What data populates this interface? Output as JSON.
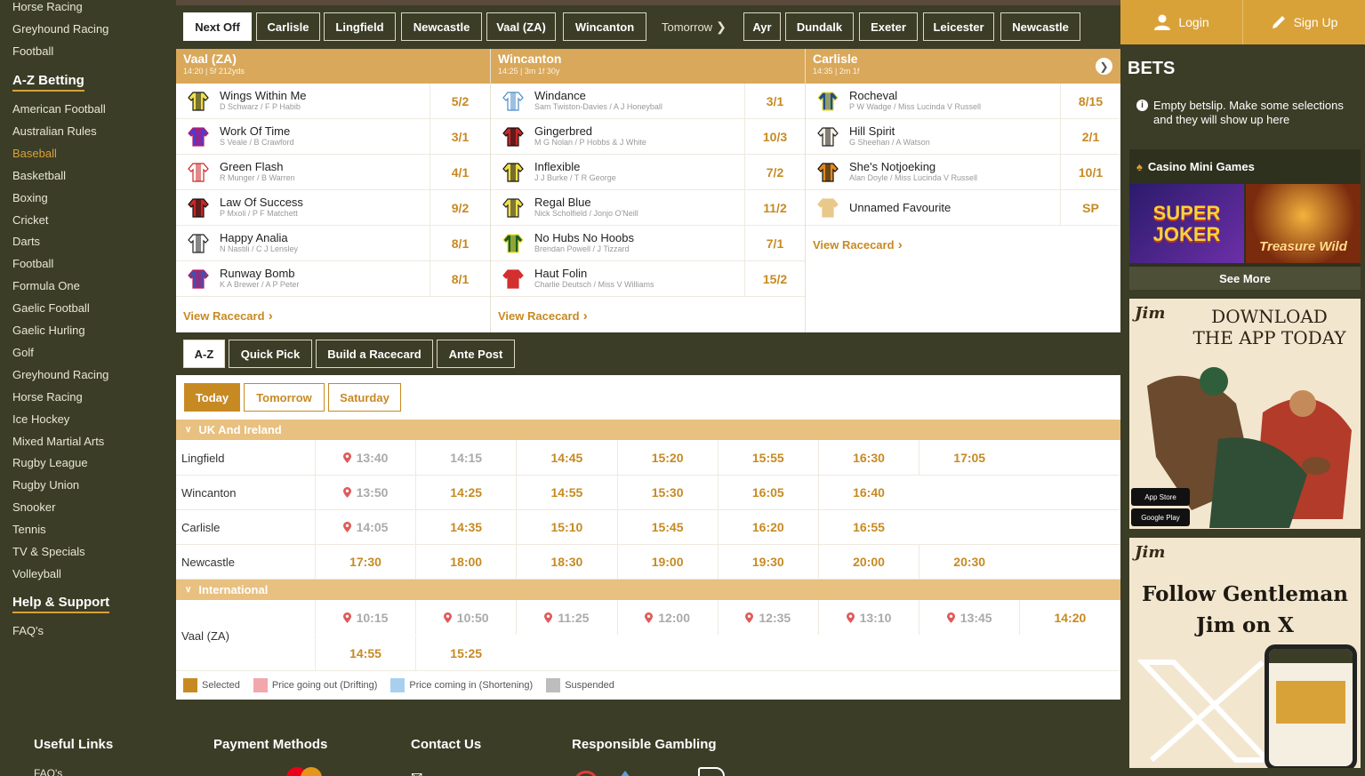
{
  "sidebar": {
    "top_links": [
      "Horse Racing",
      "Greyhound Racing",
      "Football"
    ],
    "az_heading": "A-Z Betting",
    "az_items": [
      "American Football",
      "Australian Rules",
      "Baseball",
      "Basketball",
      "Boxing",
      "Cricket",
      "Darts",
      "Football",
      "Formula One",
      "Gaelic Football",
      "Gaelic Hurling",
      "Golf",
      "Greyhound Racing",
      "Horse Racing",
      "Ice Hockey",
      "Mixed Martial Arts",
      "Rugby League",
      "Rugby Union",
      "Snooker",
      "Tennis",
      "TV & Specials",
      "Volleyball"
    ],
    "active_item": "Baseball",
    "help_heading": "Help & Support",
    "help_items": [
      "FAQ's"
    ]
  },
  "top_tabs": {
    "today": [
      "Next Off",
      "Carlisle",
      "Lingfield",
      "Newcastle",
      "Vaal (ZA)",
      "Wincanton"
    ],
    "tomorrow_label": "Tomorrow",
    "tomorrow": [
      "Ayr",
      "Dundalk",
      "Exeter",
      "Leicester",
      "Newcastle"
    ]
  },
  "races": [
    {
      "title": "Vaal (ZA)",
      "sub": "14:20 | 5f 212yds",
      "runners": [
        {
          "name": "Wings Within Me",
          "jt": "D Schwarz / F P Habib",
          "odds": "5/2"
        },
        {
          "name": "Work Of Time",
          "jt": "S Veale / B Crawford",
          "odds": "3/1"
        },
        {
          "name": "Green Flash",
          "jt": "R Munger / B Warren",
          "odds": "4/1"
        },
        {
          "name": "Law Of Success",
          "jt": "P Mxoli / P F Matchett",
          "odds": "9/2"
        },
        {
          "name": "Happy Analia",
          "jt": "N Nastili / C J Lensley",
          "odds": "8/1"
        },
        {
          "name": "Runway Bomb",
          "jt": "K A Brewer / A P Peter",
          "odds": "8/1"
        }
      ],
      "view": "View Racecard"
    },
    {
      "title": "Wincanton",
      "sub": "14:25 | 3m 1f 30y",
      "runners": [
        {
          "name": "Windance",
          "jt": "Sam Twiston-Davies / A J Honeyball",
          "odds": "3/1"
        },
        {
          "name": "Gingerbred",
          "jt": "M G Nolan / P Hobbs & J White",
          "odds": "10/3"
        },
        {
          "name": "Inflexible",
          "jt": "J J Burke / T R George",
          "odds": "7/2"
        },
        {
          "name": "Regal Blue",
          "jt": "Nick Scholfield / Jonjo O'Neill",
          "odds": "11/2"
        },
        {
          "name": "No Hubs No Hoobs",
          "jt": "Brendan Powell / J Tizzard",
          "odds": "7/1"
        },
        {
          "name": "Haut Folin",
          "jt": "Charlie Deutsch / Miss V Williams",
          "odds": "15/2"
        }
      ],
      "view": "View Racecard"
    },
    {
      "title": "Carlisle",
      "sub": "14:35 | 2m 1f",
      "runners": [
        {
          "name": "Rocheval",
          "jt": "P W Wadge / Miss Lucinda V Russell",
          "odds": "8/15"
        },
        {
          "name": "Hill Spirit",
          "jt": "G Sheehan / A Watson",
          "odds": "2/1"
        },
        {
          "name": "She's Notjoeking",
          "jt": "Alan Doyle / Miss Lucinda V Russell",
          "odds": "10/1"
        },
        {
          "name": "Unnamed Favourite",
          "jt": "",
          "odds": "SP"
        }
      ],
      "view": "View Racecard"
    }
  ],
  "mode_tabs": [
    "A-Z",
    "Quick Pick",
    "Build a Racecard",
    "Ante Post"
  ],
  "day_tabs": [
    "Today",
    "Tomorrow",
    "Saturday"
  ],
  "sections": {
    "uk": "UK And Ireland",
    "intl": "International"
  },
  "meetings_uk": [
    {
      "name": "Lingfield",
      "times": [
        "13:40",
        "14:15",
        "14:45",
        "15:20",
        "15:55",
        "16:30",
        "17:05"
      ]
    },
    {
      "name": "Wincanton",
      "times": [
        "13:50",
        "14:25",
        "14:55",
        "15:30",
        "16:05",
        "16:40"
      ]
    },
    {
      "name": "Carlisle",
      "times": [
        "14:05",
        "14:35",
        "15:10",
        "15:45",
        "16:20",
        "16:55"
      ]
    },
    {
      "name": "Newcastle",
      "times": [
        "17:30",
        "18:00",
        "18:30",
        "19:00",
        "19:30",
        "20:00",
        "20:30"
      ]
    }
  ],
  "meetings_intl": [
    {
      "name": "Vaal (ZA)",
      "times": [
        "10:15",
        "10:50",
        "11:25",
        "12:00",
        "12:35",
        "13:10",
        "13:45",
        "14:20",
        "14:55",
        "15:25"
      ]
    }
  ],
  "legend": [
    {
      "label": "Selected",
      "color": "#c78a23"
    },
    {
      "label": "Price going out (Drifting)",
      "color": "#f2a7ad"
    },
    {
      "label": "Price coming in (Shortening)",
      "color": "#a9cfee"
    },
    {
      "label": "Suspended",
      "color": "#bdbdbd"
    }
  ],
  "auth": {
    "login": "Login",
    "signup": "Sign Up"
  },
  "betslip": {
    "title": "BETS",
    "empty": "Empty betslip. Make some selections and they will show up here"
  },
  "casino": {
    "title": "Casino Mini Games",
    "games": [
      "SUPER JOKER",
      "Treasure Wild"
    ],
    "see_more": "See More"
  },
  "ads": {
    "download": {
      "brand": "Jim",
      "line1": "DOWNLOAD",
      "line2": "THE APP TODAY",
      "store1": "App Store",
      "store2": "Google Play"
    },
    "follow": {
      "brand": "Jim",
      "line1": "Follow Gentleman",
      "line2": "Jim on X"
    }
  },
  "footer": {
    "useful": "Useful Links",
    "payment": "Payment Methods",
    "contact": "Contact Us",
    "responsible": "Responsible Gambling",
    "faq": "FAQ's"
  }
}
